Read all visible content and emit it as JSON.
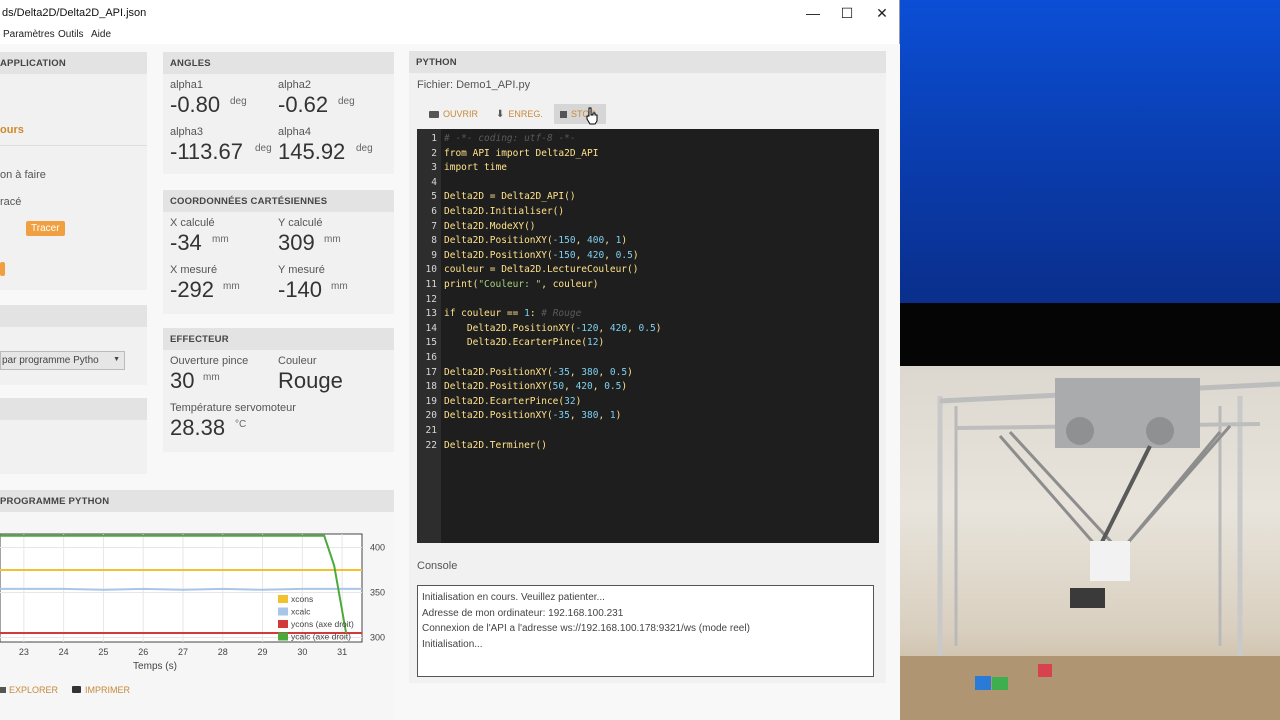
{
  "window": {
    "title": "ds/Delta2D/Delta2D_API.json",
    "minimize": "—",
    "maximize": "☐",
    "close": "✕"
  },
  "menu": [
    "Paramètres",
    "Outils",
    "Aide"
  ],
  "left_panel": {
    "header": "APPLICATION",
    "item_orange": "ours",
    "item1": "on à faire",
    "item2": "racé",
    "tracer_button": "Tracer",
    "select_value": "par programme Pytho",
    "select_arrow": "▼"
  },
  "angles": {
    "header": "ANGLES",
    "alpha1_label": "alpha1",
    "alpha1_value": "-0.80",
    "alpha1_unit": "deg",
    "alpha2_label": "alpha2",
    "alpha2_value": "-0.62",
    "alpha2_unit": "deg",
    "alpha3_label": "alpha3",
    "alpha3_value": "-113.67",
    "alpha3_unit": "deg",
    "alpha4_label": "alpha4",
    "alpha4_value": "145.92",
    "alpha4_unit": "deg"
  },
  "coords": {
    "header": "COORDONNÉES CARTÉSIENNES",
    "xc_label": "X calculé",
    "xc_value": "-34",
    "xc_unit": "mm",
    "yc_label": "Y calculé",
    "yc_value": "309",
    "yc_unit": "mm",
    "xm_label": "X mesuré",
    "xm_value": "-292",
    "xm_unit": "mm",
    "ym_label": "Y mesuré",
    "ym_value": "-140",
    "ym_unit": "mm"
  },
  "effecteur": {
    "header": "EFFECTEUR",
    "pince_label": "Ouverture pince",
    "pince_value": "30",
    "pince_unit": "mm",
    "couleur_label": "Couleur",
    "couleur_value": "Rouge",
    "temp_label": "Température servomoteur",
    "temp_value": "28.38",
    "temp_unit": "°C"
  },
  "python": {
    "header": "PYTHON",
    "file_label": "Fichier: Demo1_API.py",
    "open_label": "OUVRIR",
    "save_label": "ENREG.",
    "stop_label": "STOP",
    "console_label": "Console",
    "code_lines": [
      "# -*- coding: utf-8 -*-",
      "from API import Delta2D_API",
      "import time",
      "",
      "Delta2D = Delta2D_API()",
      "Delta2D.Initialiser()",
      "Delta2D.ModeXY()",
      "Delta2D.PositionXY(-150, 400, 1)",
      "Delta2D.PositionXY(-150, 420, 0.5)",
      "couleur = Delta2D.LectureCouleur()",
      "print(\"Couleur: \", couleur)",
      "",
      "if couleur == 1: # Rouge",
      "    Delta2D.PositionXY(-120, 420, 0.5)",
      "    Delta2D.EcarterPince(12)",
      "",
      "Delta2D.PositionXY(-35, 380, 0.5)",
      "Delta2D.PositionXY(50, 420, 0.5)",
      "Delta2D.EcarterPince(32)",
      "Delta2D.PositionXY(-35, 380, 1)",
      "",
      "Delta2D.Terminer()"
    ],
    "console_lines": [
      "Initialisation en cours. Veuillez patienter...",
      "Adresse de mon ordinateur:  192.168.100.231",
      "Connexion de l'API a l'adresse ws://192.168.100.178:9321/ws (mode reel)",
      "Initialisation..."
    ]
  },
  "chart_section": {
    "header": "PROGRAMME PYTHON",
    "explorer_label": "EXPLORER",
    "print_label": "IMPRIMER"
  },
  "chart_data": {
    "type": "line",
    "xlabel": "Temps (s)",
    "x_ticks": [
      "23",
      "24",
      "25",
      "26",
      "27",
      "28",
      "29",
      "30",
      "31"
    ],
    "xlim": [
      22.4,
      31.5
    ],
    "y2_ticks": [
      "400",
      "350",
      "300"
    ],
    "y2lim": [
      295,
      415
    ],
    "legend_position": "bottom-right",
    "series": [
      {
        "name": "xcons",
        "color": "#f2c12e",
        "axis": "left",
        "x": [
          22.4,
          31.5
        ],
        "y": [
          375,
          375
        ]
      },
      {
        "name": "xcalc",
        "color": "#a9c6e8",
        "axis": "left",
        "x": [
          22.4,
          24,
          25,
          26,
          27,
          28,
          29,
          30,
          31.5
        ],
        "y": [
          354,
          354,
          353,
          354,
          353,
          354,
          353,
          354,
          354
        ]
      },
      {
        "name": "ycons (axe droit)",
        "color": "#d23a3a",
        "axis": "right",
        "x": [
          22.4,
          31.5
        ],
        "y": [
          305,
          305
        ]
      },
      {
        "name": "ycalc (axe droit)",
        "color": "#4caa3c",
        "axis": "right",
        "x": [
          22.4,
          30.55,
          30.8,
          31.1
        ],
        "y": [
          413,
          413,
          380,
          305
        ]
      }
    ]
  }
}
